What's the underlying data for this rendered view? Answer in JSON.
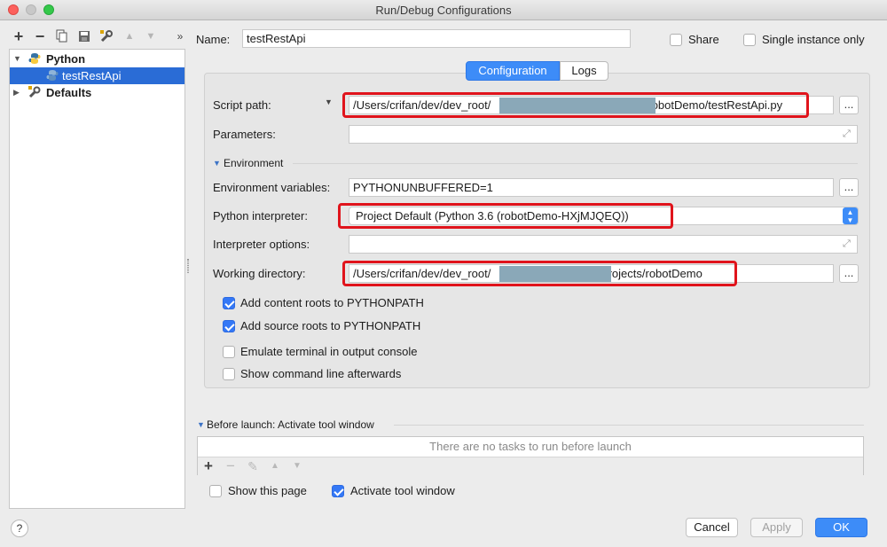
{
  "window": {
    "title": "Run/Debug Configurations"
  },
  "tree": {
    "toolbar": [
      "add-icon",
      "remove-icon",
      "copy-icon",
      "save-icon",
      "wrench-icon",
      "move-up-icon",
      "move-down-icon",
      "more-icon"
    ],
    "items": [
      {
        "label": "Python",
        "expanded": true
      },
      {
        "label": "testRestApi",
        "selected": true
      },
      {
        "label": "Defaults",
        "expanded": false
      }
    ]
  },
  "name": {
    "label": "Name:",
    "value": "testRestApi"
  },
  "share": {
    "label": "Share",
    "checked": false
  },
  "single_instance": {
    "label": "Single instance only",
    "checked": false
  },
  "tabs": [
    {
      "label": "Configuration",
      "active": true
    },
    {
      "label": "Logs",
      "active": false
    }
  ],
  "script_path": {
    "label": "Script path:",
    "value_prefix": "/Users/crifan/dev/dev_root/",
    "value_suffix": "robotDemo/testRestApi.py",
    "browse": "..."
  },
  "parameters": {
    "label": "Parameters:",
    "value": ""
  },
  "environment": {
    "section": "Environment"
  },
  "env_vars": {
    "label": "Environment variables:",
    "value": "PYTHONUNBUFFERED=1",
    "browse": "..."
  },
  "interpreter": {
    "label": "Python interpreter:",
    "value": "Project Default (Python 3.6 (robotDemo-HXjMJQEQ))"
  },
  "interpreter_options": {
    "label": "Interpreter options:",
    "value": ""
  },
  "working_dir": {
    "label": "Working directory:",
    "value_prefix": "/Users/crifan/dev/dev_root/",
    "value_suffix": "projects/robotDemo",
    "browse": "..."
  },
  "checkboxes": [
    {
      "label": "Add content roots to PYTHONPATH",
      "checked": true
    },
    {
      "label": "Add source roots to PYTHONPATH",
      "checked": true
    },
    {
      "label": "Emulate terminal in output console",
      "checked": false
    },
    {
      "label": "Show command line afterwards",
      "checked": false
    }
  ],
  "before_launch": {
    "title": "Before launch: Activate tool window",
    "empty_text": "There are no tasks to run before launch"
  },
  "show_page": {
    "label": "Show this page",
    "checked": false
  },
  "activate_tool": {
    "label": "Activate tool window",
    "checked": true
  },
  "buttons": {
    "cancel": "Cancel",
    "apply": "Apply",
    "ok": "OK",
    "help": "?"
  },
  "colors": {
    "accent": "#3d8cf8",
    "highlight_box": "#e0141c",
    "selection": "#2a6cd6"
  }
}
